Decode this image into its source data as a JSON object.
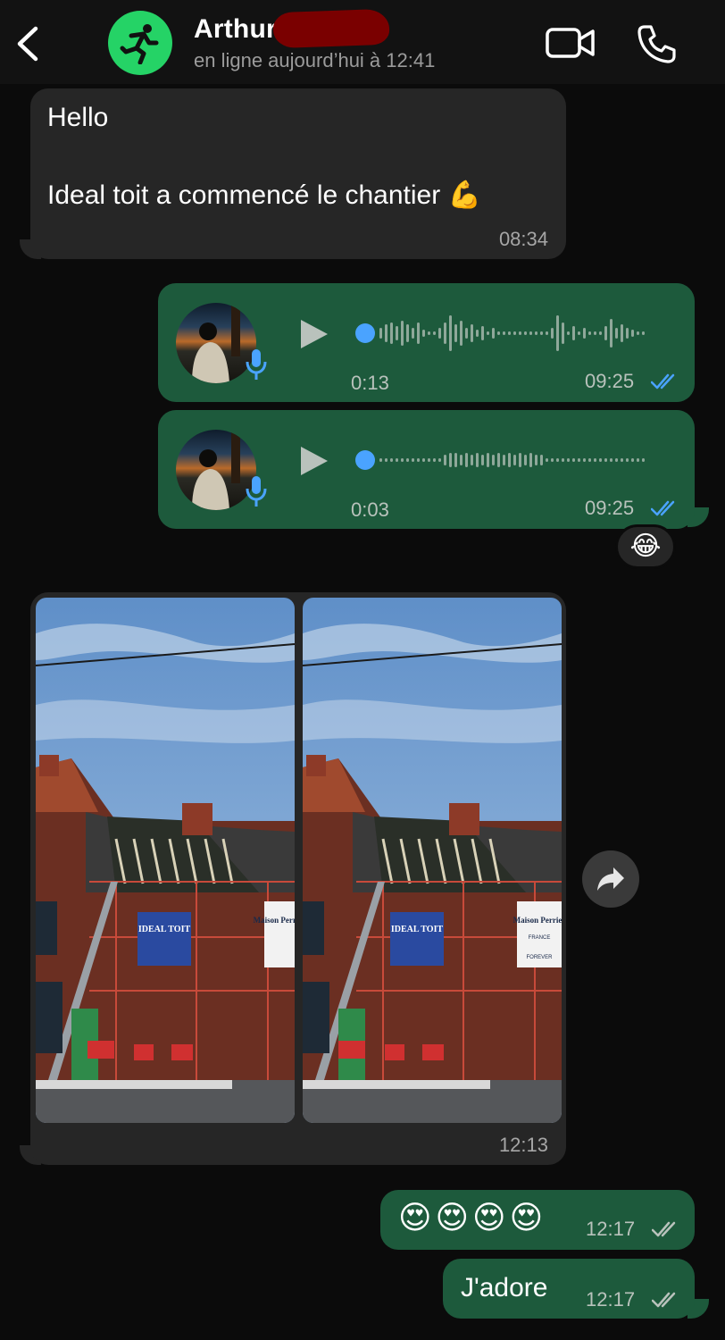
{
  "header": {
    "contact_name": "Arthur",
    "status": "en ligne aujourd’hui à 12:41",
    "back_icon": "chevron-left-icon",
    "video_icon": "video-camera-icon",
    "call_icon": "phone-icon"
  },
  "messages": [
    {
      "direction": "in",
      "line1": "Hello",
      "line2": "Ideal toit a commencé le chantier 💪",
      "time": "08:34"
    },
    {
      "direction": "out",
      "type": "voice",
      "duration": "0:13",
      "time": "09:25",
      "read": true
    },
    {
      "direction": "out",
      "type": "voice",
      "duration": "0:03",
      "time": "09:25",
      "read": true,
      "reaction": "😂"
    },
    {
      "direction": "in",
      "type": "photos",
      "count": 2,
      "time": "12:13",
      "sign_left": "IDEAL TOIT",
      "sign_right": "Maison Perrier",
      "sign_right_sub": "FRANCE",
      "sign_right_foot": "FOREVER"
    },
    {
      "direction": "out",
      "text": "😍😍😍😍",
      "time": "12:17",
      "read": true
    },
    {
      "direction": "out",
      "text": "J'adore",
      "time": "12:17",
      "read": true
    }
  ],
  "colors": {
    "background": "#0b0b0b",
    "incoming": "#262626",
    "outgoing": "#1d5a3c",
    "accent_blue": "#4aa3ff",
    "header_avatar": "#25d366"
  }
}
